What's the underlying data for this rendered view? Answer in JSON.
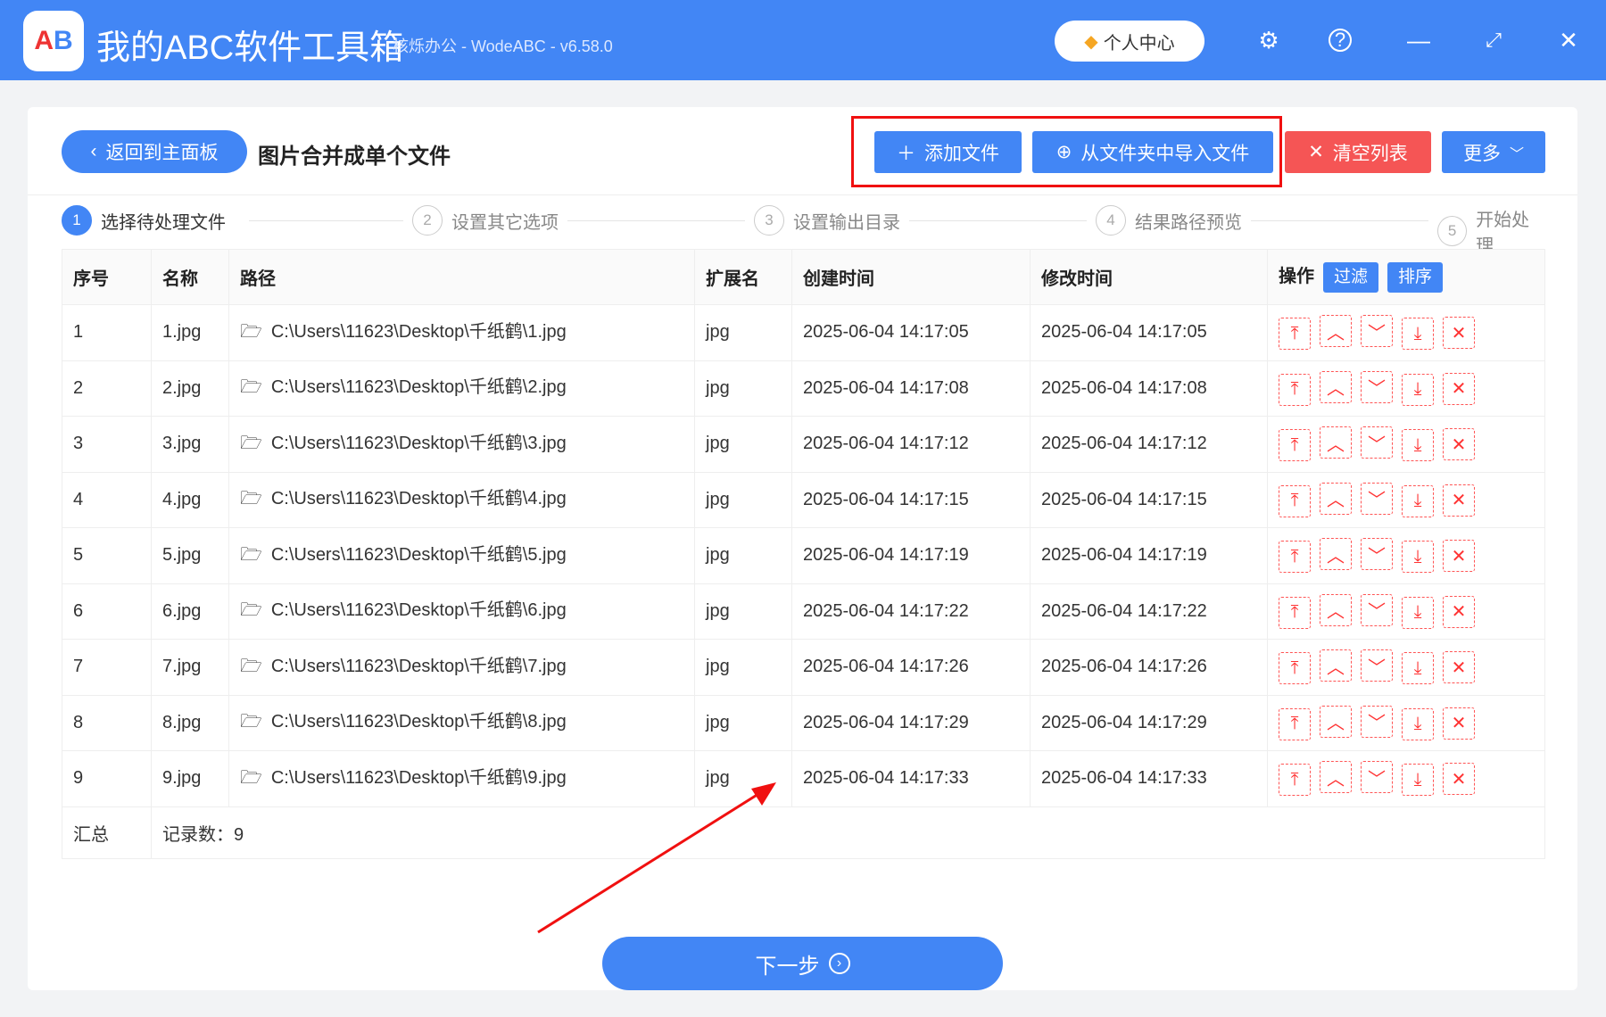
{
  "header": {
    "title": "我的ABC软件工具箱",
    "subtitle": "核烁办公 - WodeABC - v6.58.0",
    "personal_center": "个人中心",
    "logo_text": "AB"
  },
  "toolbar": {
    "back": "返回到主面板",
    "page_title": "图片合并成单个文件",
    "add_file": "添加文件",
    "import_folder": "从文件夹中导入文件",
    "clear_list": "清空列表",
    "more": "更多"
  },
  "steps": [
    {
      "num": "1",
      "label": "选择待处理文件"
    },
    {
      "num": "2",
      "label": "设置其它选项"
    },
    {
      "num": "3",
      "label": "设置输出目录"
    },
    {
      "num": "4",
      "label": "结果路径预览"
    },
    {
      "num": "5",
      "label": "开始处理"
    }
  ],
  "table": {
    "headers": {
      "index": "序号",
      "name": "名称",
      "path": "路径",
      "ext": "扩展名",
      "created": "创建时间",
      "modified": "修改时间",
      "actions": "操作",
      "filter": "过滤",
      "sort": "排序"
    },
    "rows": [
      {
        "index": "1",
        "name": "1.jpg",
        "path": "C:\\Users\\11623\\Desktop\\千纸鹤\\1.jpg",
        "ext": "jpg",
        "created": "2025-06-04 14:17:05",
        "modified": "2025-06-04 14:17:05"
      },
      {
        "index": "2",
        "name": "2.jpg",
        "path": "C:\\Users\\11623\\Desktop\\千纸鹤\\2.jpg",
        "ext": "jpg",
        "created": "2025-06-04 14:17:08",
        "modified": "2025-06-04 14:17:08"
      },
      {
        "index": "3",
        "name": "3.jpg",
        "path": "C:\\Users\\11623\\Desktop\\千纸鹤\\3.jpg",
        "ext": "jpg",
        "created": "2025-06-04 14:17:12",
        "modified": "2025-06-04 14:17:12"
      },
      {
        "index": "4",
        "name": "4.jpg",
        "path": "C:\\Users\\11623\\Desktop\\千纸鹤\\4.jpg",
        "ext": "jpg",
        "created": "2025-06-04 14:17:15",
        "modified": "2025-06-04 14:17:15"
      },
      {
        "index": "5",
        "name": "5.jpg",
        "path": "C:\\Users\\11623\\Desktop\\千纸鹤\\5.jpg",
        "ext": "jpg",
        "created": "2025-06-04 14:17:19",
        "modified": "2025-06-04 14:17:19"
      },
      {
        "index": "6",
        "name": "6.jpg",
        "path": "C:\\Users\\11623\\Desktop\\千纸鹤\\6.jpg",
        "ext": "jpg",
        "created": "2025-06-04 14:17:22",
        "modified": "2025-06-04 14:17:22"
      },
      {
        "index": "7",
        "name": "7.jpg",
        "path": "C:\\Users\\11623\\Desktop\\千纸鹤\\7.jpg",
        "ext": "jpg",
        "created": "2025-06-04 14:17:26",
        "modified": "2025-06-04 14:17:26"
      },
      {
        "index": "8",
        "name": "8.jpg",
        "path": "C:\\Users\\11623\\Desktop\\千纸鹤\\8.jpg",
        "ext": "jpg",
        "created": "2025-06-04 14:17:29",
        "modified": "2025-06-04 14:17:29"
      },
      {
        "index": "9",
        "name": "9.jpg",
        "path": "C:\\Users\\11623\\Desktop\\千纸鹤\\9.jpg",
        "ext": "jpg",
        "created": "2025-06-04 14:17:33",
        "modified": "2025-06-04 14:17:33"
      }
    ],
    "summary_label": "汇总",
    "summary_count": "记录数：9"
  },
  "next": "下一步",
  "colors": {
    "primary": "#4286f5",
    "danger": "#f55555",
    "annotation": "#f01010"
  }
}
